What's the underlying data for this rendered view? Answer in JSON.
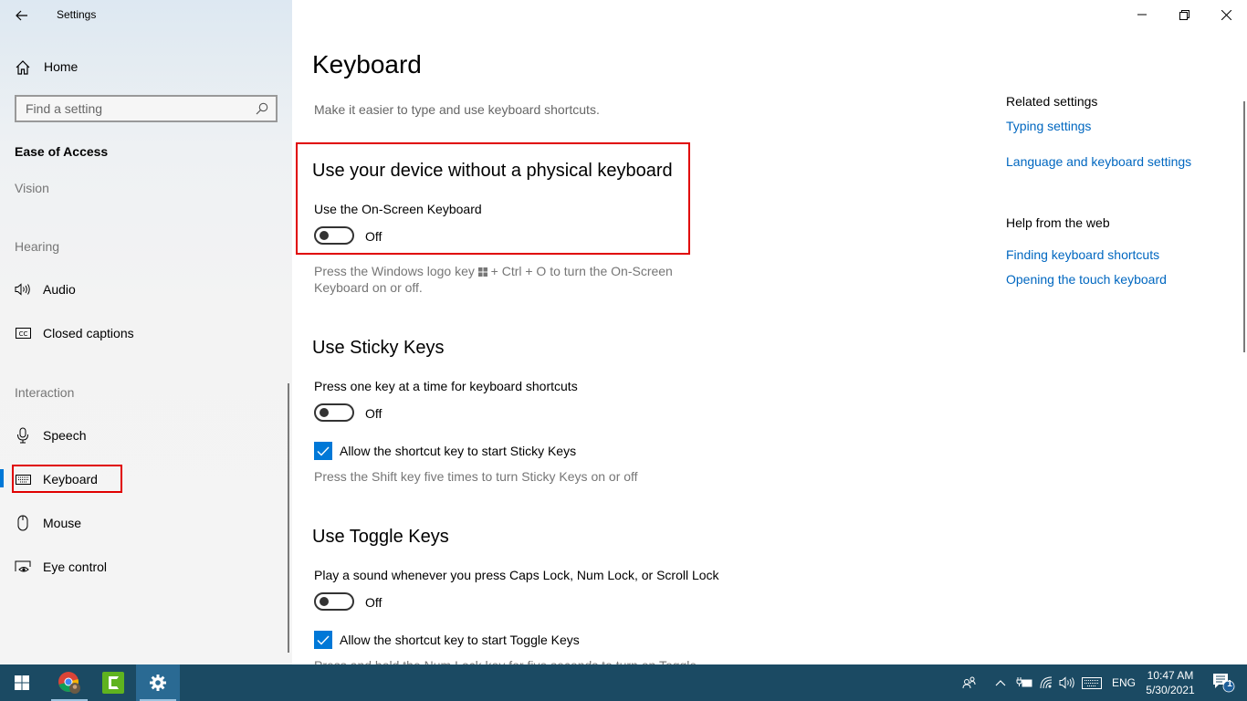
{
  "window": {
    "app_title": "Settings",
    "controls": {
      "minimize": "minimize-icon",
      "restore": "restore-icon",
      "close": "close-icon"
    }
  },
  "sidebar": {
    "home_label": "Home",
    "search": {
      "placeholder": "Find a setting",
      "value": ""
    },
    "section_title": "Ease of Access",
    "groups": [
      {
        "label": "Vision",
        "items": []
      },
      {
        "label": "Hearing",
        "items": [
          {
            "label": "Audio",
            "icon": "speaker-icon"
          },
          {
            "label": "Closed captions",
            "icon": "closed-captions-icon"
          }
        ]
      },
      {
        "label": "Interaction",
        "items": [
          {
            "label": "Speech",
            "icon": "microphone-icon"
          },
          {
            "label": "Keyboard",
            "icon": "keyboard-icon",
            "selected": true
          },
          {
            "label": "Mouse",
            "icon": "mouse-icon"
          },
          {
            "label": "Eye control",
            "icon": "eye-control-icon"
          }
        ]
      }
    ]
  },
  "main": {
    "title": "Keyboard",
    "description": "Make it easier to type and use keyboard shortcuts.",
    "sections": [
      {
        "heading": "Use your device without a physical keyboard",
        "setting_label": "Use the On-Screen Keyboard",
        "toggle_state": "Off",
        "help_text_before": "Press the Windows logo key",
        "help_text_after": "+ Ctrl + O to turn the On-Screen",
        "help_text_line2": "Keyboard on or off."
      },
      {
        "heading": "Use Sticky Keys",
        "setting_label": "Press one key at a time for keyboard shortcuts",
        "toggle_state": "Off",
        "checkbox_label": "Allow the shortcut key to start Sticky Keys",
        "checkbox_checked": true,
        "help_text": "Press the Shift key five times to turn Sticky Keys on or off"
      },
      {
        "heading": "Use Toggle Keys",
        "setting_label": "Play a sound whenever you press Caps Lock, Num Lock, or Scroll Lock",
        "toggle_state": "Off",
        "checkbox_label": "Allow the shortcut key to start Toggle Keys",
        "checkbox_checked": true,
        "help_text": "Press and hold the Num Lock key for five seconds to turn on Toggle"
      }
    ],
    "related": {
      "title": "Related settings",
      "links": [
        "Typing settings",
        "Language and keyboard settings"
      ],
      "help_title": "Help from the web",
      "help_links": [
        "Finding keyboard shortcuts",
        "Opening the touch keyboard"
      ]
    }
  },
  "taskbar": {
    "apps": [
      "start",
      "chrome",
      "camtasia",
      "settings"
    ],
    "tray": {
      "language": "ENG",
      "time": "10:47 AM",
      "date": "5/30/2021",
      "notification_count": "1"
    }
  },
  "colors": {
    "accent": "#0078d7",
    "link": "#0067c0",
    "highlight_box": "#e00000",
    "taskbar": "#1b4a63"
  }
}
